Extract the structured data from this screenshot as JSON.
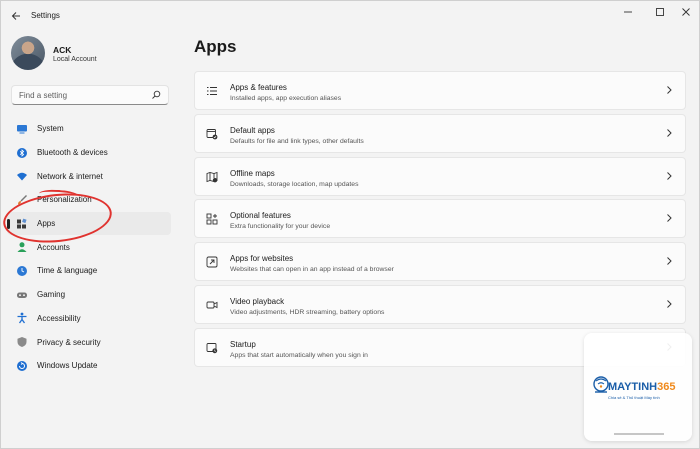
{
  "window": {
    "title": "Settings"
  },
  "profile": {
    "name": "ACK",
    "account_type": "Local Account"
  },
  "search": {
    "placeholder": "Find a setting"
  },
  "sidebar": {
    "items": [
      {
        "label": "System",
        "icon": "monitor-icon",
        "color": "#2b78d4"
      },
      {
        "label": "Bluetooth & devices",
        "icon": "bluetooth-icon",
        "color": "#1f6fd1"
      },
      {
        "label": "Network & internet",
        "icon": "wifi-icon",
        "color": "#1f6fd1"
      },
      {
        "label": "Personalization",
        "icon": "brush-icon",
        "color": "#e07a2c"
      },
      {
        "label": "Apps",
        "icon": "apps-icon",
        "color": "#3a3a3a",
        "active": true
      },
      {
        "label": "Accounts",
        "icon": "person-icon",
        "color": "#2aa05a"
      },
      {
        "label": "Time & language",
        "icon": "globe-clock-icon",
        "color": "#2b78d4"
      },
      {
        "label": "Gaming",
        "icon": "controller-icon",
        "color": "#777777"
      },
      {
        "label": "Accessibility",
        "icon": "accessibility-icon",
        "color": "#1f6fd1"
      },
      {
        "label": "Privacy & security",
        "icon": "shield-icon",
        "color": "#777777"
      },
      {
        "label": "Windows Update",
        "icon": "update-icon",
        "color": "#1f6fd1"
      }
    ]
  },
  "main": {
    "title": "Apps",
    "cards": [
      {
        "title": "Apps & features",
        "desc": "Installed apps, app execution aliases",
        "icon": "list-icon"
      },
      {
        "title": "Default apps",
        "desc": "Defaults for file and link types, other defaults",
        "icon": "default-apps-icon"
      },
      {
        "title": "Offline maps",
        "desc": "Downloads, storage location, map updates",
        "icon": "map-icon"
      },
      {
        "title": "Optional features",
        "desc": "Extra functionality for your device",
        "icon": "grid-plus-icon"
      },
      {
        "title": "Apps for websites",
        "desc": "Websites that can open in an app instead of a browser",
        "icon": "open-in-app-icon"
      },
      {
        "title": "Video playback",
        "desc": "Video adjustments, HDR streaming, battery options",
        "icon": "video-icon"
      },
      {
        "title": "Startup",
        "desc": "Apps that start automatically when you sign in",
        "icon": "startup-icon"
      }
    ]
  },
  "watermark": {
    "brand_a": "MAYTINH",
    "brand_b": "365",
    "tagline": "Chia sẻ & Thủ thuật Máy tính"
  },
  "colors": {
    "accent": "#0067c0",
    "annotation": "#e0332f"
  }
}
